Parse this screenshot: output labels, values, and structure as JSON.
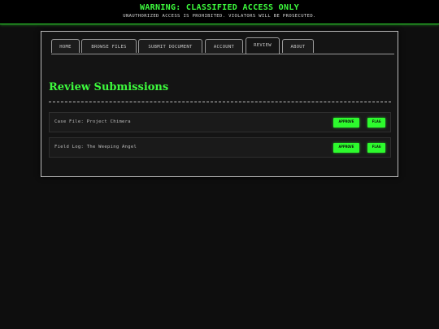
{
  "banner": {
    "title": "WARNING: CLASSIFIED ACCESS ONLY",
    "subtitle": "UNAUTHORIZED ACCESS IS PROHIBITED. VIOLATORS WILL BE PROSECUTED."
  },
  "tabs": [
    {
      "label": "HOME"
    },
    {
      "label": "BROWSE FILES"
    },
    {
      "label": "SUBMIT DOCUMENT"
    },
    {
      "label": "ACCOUNT"
    },
    {
      "label": "REVIEW",
      "active": true
    },
    {
      "label": "ABOUT"
    }
  ],
  "page": {
    "title": "Review Submissions"
  },
  "submissions": [
    {
      "label": "Case File: Project Chimera",
      "approve": "APPROVE",
      "flag": "FLAG"
    },
    {
      "label": "Field Log: The Weeping Angel",
      "approve": "APPROVE",
      "flag": "FLAG"
    }
  ],
  "colors": {
    "accent": "#3dfb3d",
    "background": "#0e0e0e",
    "panel": "#141414"
  }
}
